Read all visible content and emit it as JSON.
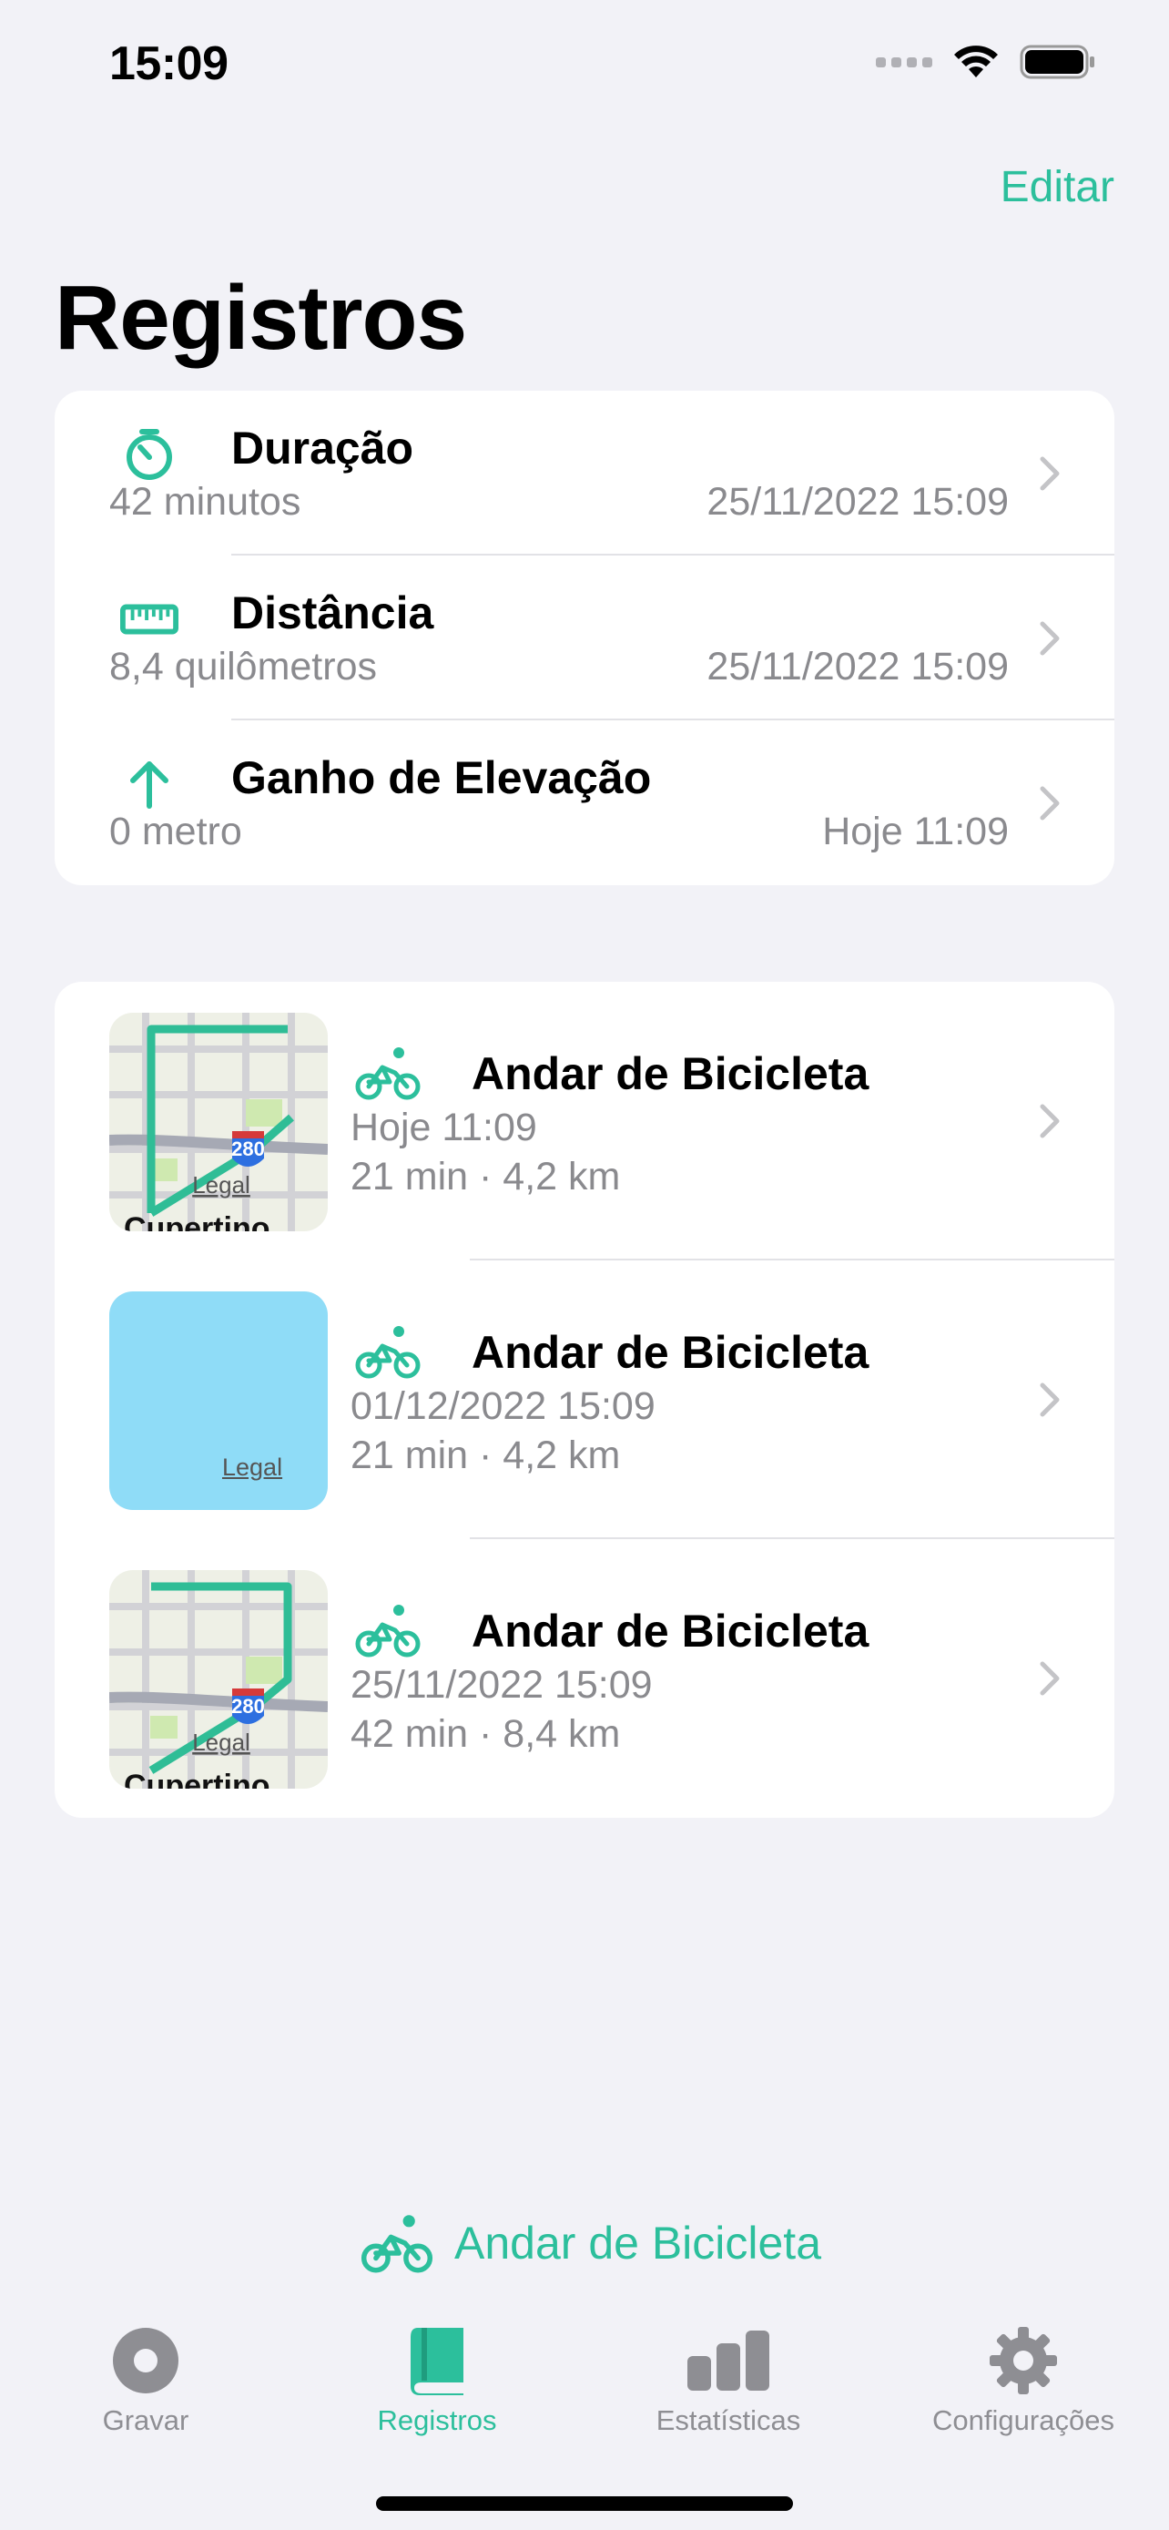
{
  "status": {
    "time": "15:09"
  },
  "nav": {
    "edit_label": "Editar",
    "title": "Registros"
  },
  "summary": [
    {
      "icon": "timer-icon",
      "title": "Duração",
      "value": "42 minutos",
      "date": "25/11/2022 15:09"
    },
    {
      "icon": "ruler-icon",
      "title": "Distância",
      "value": "8,4 quilômetros",
      "date": "25/11/2022 15:09"
    },
    {
      "icon": "arrow-up-icon",
      "title": "Ganho de Elevação",
      "value": "0 metro",
      "date": "Hoje 11:09"
    }
  ],
  "workouts": [
    {
      "title": "Andar de Bicicleta",
      "date": "Hoje 11:09",
      "stats": "21 min · 4,2 km",
      "map": "map",
      "shield": "280",
      "legal": "Legal",
      "place": "Cupertino"
    },
    {
      "title": "Andar de Bicicleta",
      "date": "01/12/2022 15:09",
      "stats": "21 min · 4,2 km",
      "map": "blank",
      "legal": "Legal"
    },
    {
      "title": "Andar de Bicicleta",
      "date": "25/11/2022 15:09",
      "stats": "42 min · 8,4 km",
      "map": "map",
      "shield": "280",
      "legal": "Legal",
      "place": "Cupertino"
    }
  ],
  "start_workout": {
    "label": "Andar de Bicicleta"
  },
  "tabs": [
    {
      "label": "Gravar",
      "icon": "record-icon",
      "active": false
    },
    {
      "label": "Registros",
      "icon": "book-icon",
      "active": true
    },
    {
      "label": "Estatísticas",
      "icon": "bar-chart-icon",
      "active": false
    },
    {
      "label": "Configurações",
      "icon": "gear-icon",
      "active": false
    }
  ],
  "colors": {
    "accent": "#2cbf9c",
    "secondary_text": "#8a8a8e",
    "background": "#f2f2f7"
  }
}
